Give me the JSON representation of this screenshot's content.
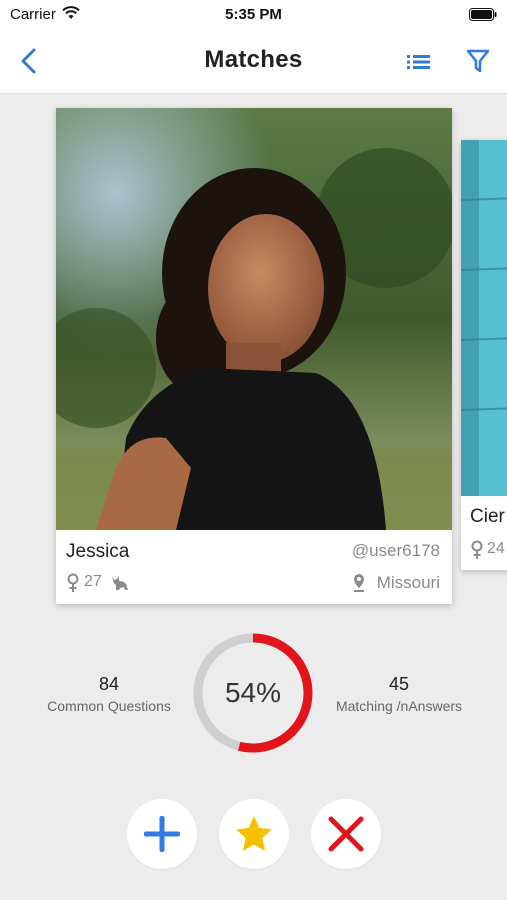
{
  "status_bar": {
    "carrier": "Carrier",
    "time": "5:35 PM"
  },
  "nav": {
    "title": "Matches"
  },
  "profile": {
    "name": "Jessica",
    "username": "@user6178",
    "age": "27",
    "location": "Missouri"
  },
  "next_profile": {
    "name_partial": "Cier",
    "age_partial": "24"
  },
  "stats": {
    "common_questions_value": "84",
    "common_questions_label": "Common Questions",
    "match_percent_text": "54%",
    "match_fraction": 0.54,
    "matching_answers_value": "45",
    "matching_answers_label": "Matching /nAnswers"
  },
  "colors": {
    "accent_blue": "#2f7ae5",
    "ring_red": "#e3131b",
    "ring_gray": "#cfcfcf",
    "star_yellow": "#f5c000",
    "reject_red": "#e3131b"
  },
  "icons": {
    "back": "chevron-left-icon",
    "list": "list-icon",
    "filter": "filter-icon",
    "gender": "female-icon",
    "pet": "cat-icon",
    "location": "location-pin-icon",
    "add": "plus-icon",
    "favorite": "star-icon",
    "reject": "close-icon"
  }
}
